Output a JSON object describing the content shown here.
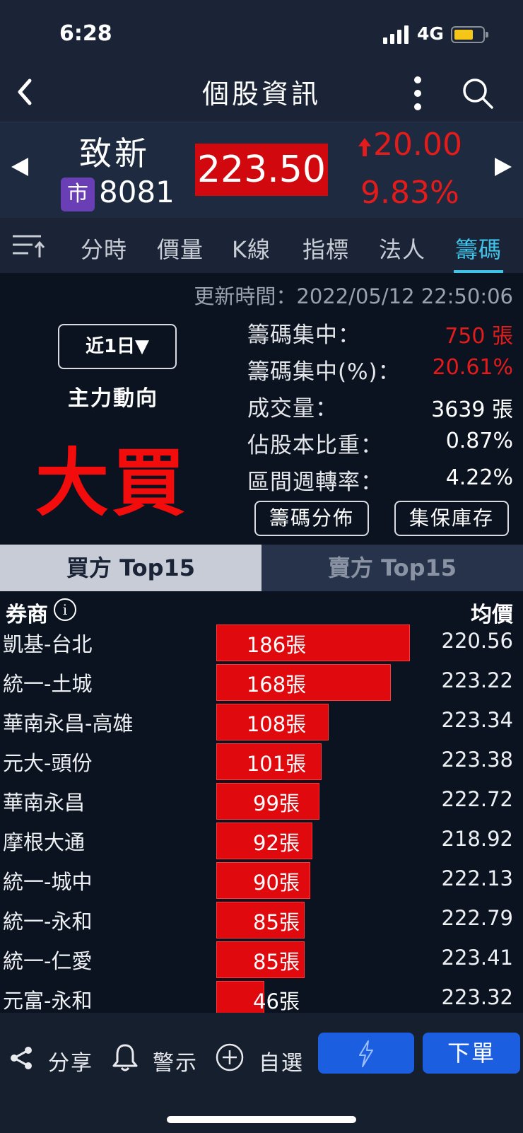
{
  "status": {
    "time": "6:28",
    "network": "4G",
    "battery_color": "#f5c518"
  },
  "nav": {
    "title": "個股資訊"
  },
  "stock": {
    "name": "致新",
    "market_badge": "市",
    "code": "8081",
    "price": "223.50",
    "change": "20.00",
    "change_pct": "9.83%",
    "up_color": "#e41b1b"
  },
  "tabs": [
    {
      "label": "分時"
    },
    {
      "label": "價量"
    },
    {
      "label": "K線"
    },
    {
      "label": "指標"
    },
    {
      "label": "法人"
    },
    {
      "label": "籌碼",
      "active": true
    }
  ],
  "chips": {
    "update_time": "更新時間：2022/05/12 22:50:06",
    "period": "近1日▼",
    "main_force_label": "主力動向",
    "main_force_value": "大買",
    "stats": [
      {
        "label": "籌碼集中：",
        "value": "750 張",
        "red": true
      },
      {
        "label": "籌碼集中(%)：",
        "value": "20.61%",
        "red": true
      },
      {
        "label": "成交量：",
        "value": "3639 張",
        "red": false
      },
      {
        "label": "佔股本比重：",
        "value": "0.87%",
        "red": false
      },
      {
        "label": "區間週轉率：",
        "value": "4.22%",
        "red": false
      }
    ],
    "distribution_button": "籌碼分佈",
    "custody_button": "集保庫存"
  },
  "ranking": {
    "buy_tab": "買方 Top15",
    "sell_tab": "賣方 Top15",
    "col_broker": "券商",
    "col_avg": "均價",
    "rows": [
      {
        "broker": "凱基-台北",
        "volume": "186張",
        "volume_value": 186,
        "avg": "220.56"
      },
      {
        "broker": "統一-土城",
        "volume": "168張",
        "volume_value": 168,
        "avg": "223.22"
      },
      {
        "broker": "華南永昌-高雄",
        "volume": "108張",
        "volume_value": 108,
        "avg": "223.34"
      },
      {
        "broker": "元大-頭份",
        "volume": "101張",
        "volume_value": 101,
        "avg": "223.38"
      },
      {
        "broker": "華南永昌",
        "volume": "99張",
        "volume_value": 99,
        "avg": "222.72"
      },
      {
        "broker": "摩根大通",
        "volume": "92張",
        "volume_value": 92,
        "avg": "218.92"
      },
      {
        "broker": "統一-城中",
        "volume": "90張",
        "volume_value": 90,
        "avg": "222.13"
      },
      {
        "broker": "統一-永和",
        "volume": "85張",
        "volume_value": 85,
        "avg": "222.79"
      },
      {
        "broker": "統一-仁愛",
        "volume": "85張",
        "volume_value": 85,
        "avg": "223.41"
      },
      {
        "broker": "元富-永和",
        "volume": "46張",
        "volume_value": 46,
        "avg": "223.32"
      }
    ]
  },
  "bottom": {
    "share_label": "分享",
    "alert_label": "警示",
    "watch_label": "自選",
    "order_label": "下單"
  }
}
